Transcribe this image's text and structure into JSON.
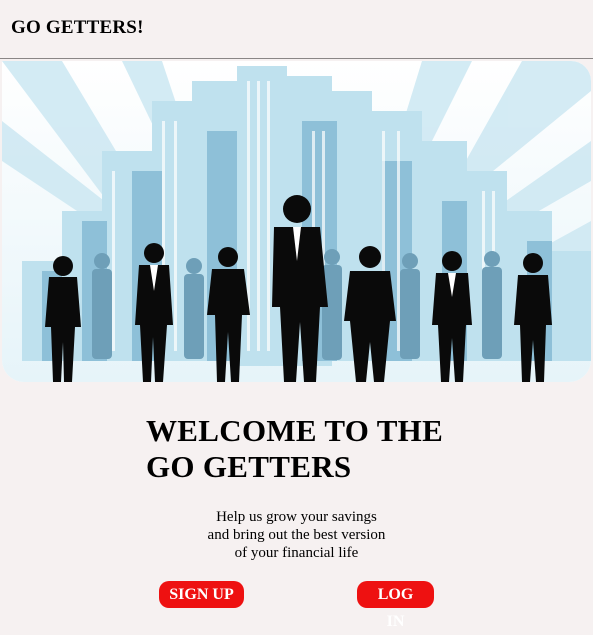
{
  "header": {
    "brand": "GO GETTERS!"
  },
  "hero": {
    "image": "business-team-city-skyline-illustration"
  },
  "welcome": {
    "line1": "WELCOME TO THE",
    "line2": "GO GETTERS"
  },
  "tagline": {
    "line1": "Help us grow your savings",
    "line2": "and bring out the best version",
    "line3": "of your financial life"
  },
  "actions": {
    "signup_label": "SIGN UP",
    "login_label": "LOG IN"
  },
  "colors": {
    "background": "#f6f1f1",
    "button": "#ee1111",
    "sky_light": "#dbeff6",
    "building_light": "#a9d3e6",
    "building_mid": "#6fa6c2",
    "silhouette": "#0a0a0a"
  }
}
